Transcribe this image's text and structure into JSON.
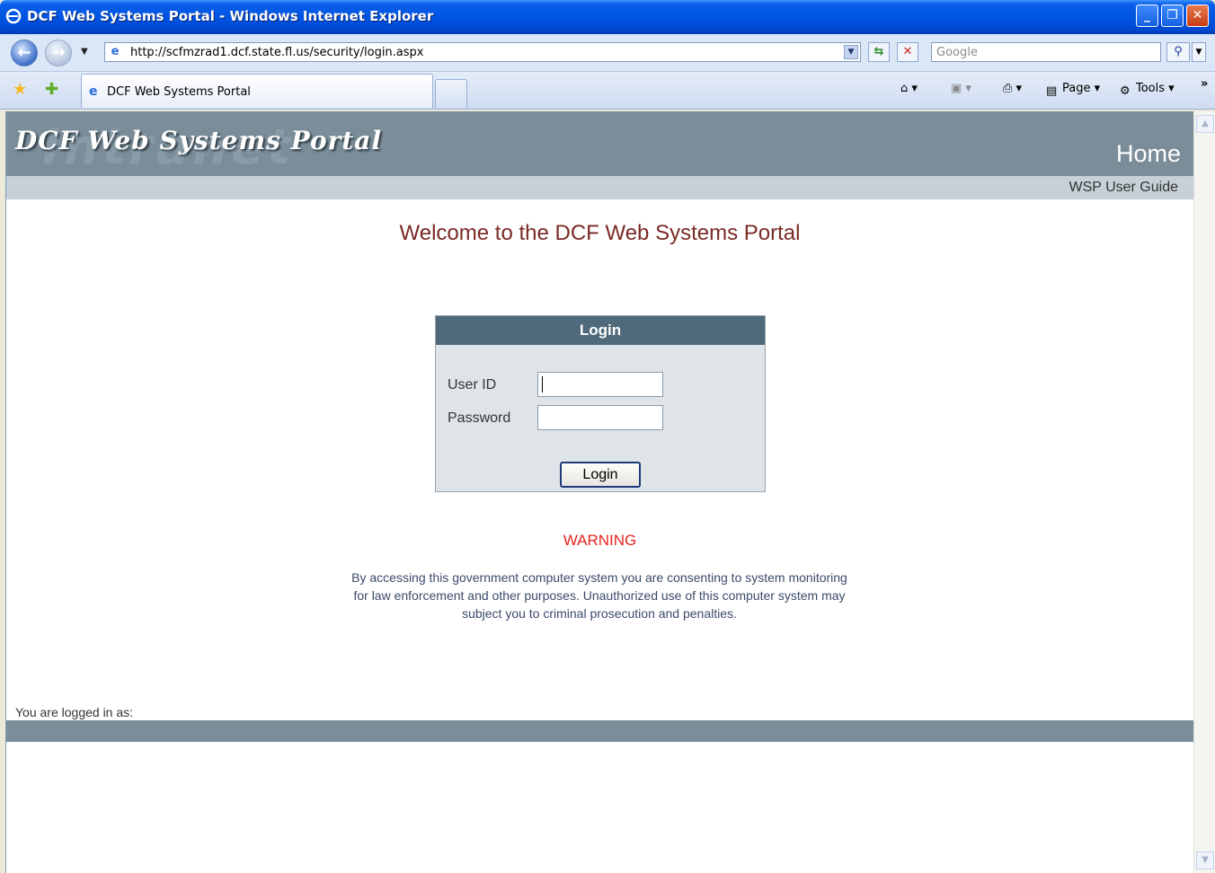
{
  "window": {
    "title": "DCF Web Systems Portal - Windows Internet Explorer",
    "minimize": "_",
    "maximize": "❐",
    "close": "✕"
  },
  "address_bar": {
    "url": "http://scfmzrad1.dcf.state.fl.us/security/login.aspx",
    "search_placeholder": "Google"
  },
  "tabs": [
    {
      "label": "DCF Web Systems Portal",
      "active": true
    }
  ],
  "command_bar": {
    "page_label": "Page",
    "tools_label": "Tools"
  },
  "page": {
    "logo": "DCF Web Systems Portal",
    "nav_home": "Home",
    "user_guide": "WSP User Guide",
    "welcome": "Welcome to the DCF Web Systems Portal",
    "login": {
      "header": "Login",
      "userid_label": "User ID",
      "userid_value": "",
      "password_label": "Password",
      "password_value": "",
      "button": "Login"
    },
    "warning_title": "WARNING",
    "warning_lines": [
      "By accessing this government computer system you are consenting to system monitoring",
      "for law enforcement and other purposes. Unauthorized use of this computer system may",
      "subject you to criminal prosecution and penalties."
    ],
    "logged_in_as": "You are logged in as:"
  },
  "colors": {
    "header_bg": "#7a8d98",
    "subnav_bg": "#c5d0d7",
    "login_header_bg": "#4f6a7a",
    "login_panel_bg": "#dfe4e9",
    "welcome_text": "#7a2a25",
    "warning_text": "#e3241f"
  }
}
